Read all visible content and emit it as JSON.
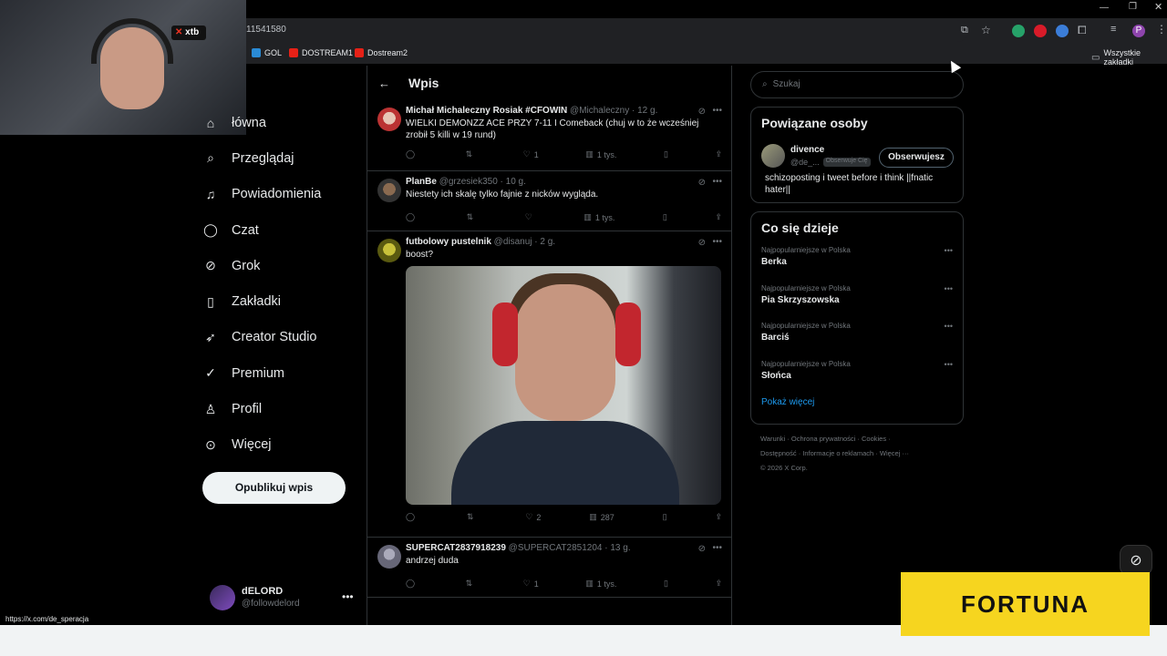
{
  "browser": {
    "url_fragment": "11541580",
    "bookmarks": [
      "GOL",
      "DOSTREAM1",
      "Dostream2"
    ],
    "bookmarks_folder": "Wszystkie zakładki",
    "profile_initial": "P"
  },
  "overlay": {
    "xtb_label": "xtb",
    "sponsor": "FORTUNA"
  },
  "nav": {
    "items": [
      {
        "label": "łówna",
        "icon": "home-icon"
      },
      {
        "label": "Przeglądaj",
        "icon": "search-icon"
      },
      {
        "label": "Powiadomienia",
        "icon": "bell-icon"
      },
      {
        "label": "Czat",
        "icon": "chat-icon"
      },
      {
        "label": "Grok",
        "icon": "grok-icon"
      },
      {
        "label": "Zakładki",
        "icon": "bookmark-icon"
      },
      {
        "label": "Creator Studio",
        "icon": "rocket-icon"
      },
      {
        "label": "Premium",
        "icon": "verified-icon"
      },
      {
        "label": "Profil",
        "icon": "person-icon"
      },
      {
        "label": "Więcej",
        "icon": "more-circle-icon"
      }
    ],
    "post_button": "Opublikuj wpis",
    "account": {
      "name": "dELORD",
      "handle": "@followdelord"
    }
  },
  "status_url": "https://x.com/de_speracja",
  "main": {
    "title": "Wpis",
    "posts": [
      {
        "name": "Michał Michaleczny Rosiak #CFOWIN",
        "handle": "@Michaleczny",
        "time": "· 12 g.",
        "text": "WIELKI DEMONZZ ACE PRZY 7-11 I Comeback (chuj w to że wcześniej zrobił 5 killi w 19 rund)",
        "replies": "",
        "reposts": "",
        "likes": "1",
        "views": "1 tys."
      },
      {
        "name": "PlanBe",
        "handle": "@grzesiek350",
        "time": "· 10 g.",
        "text": "Niestety ich skalę tylko fajnie z nicków wygląda.",
        "replies": "",
        "reposts": "",
        "likes": "",
        "views": "1 tys."
      },
      {
        "name": "futbolowy pustelnik",
        "handle": "@disanuj",
        "time": "· 2 g.",
        "text": "boost?",
        "replies": "",
        "reposts": "",
        "likes": "2",
        "views": "287"
      },
      {
        "name": "SUPERCAT2837918239",
        "handle": "@SUPERCAT2851204",
        "time": "· 13 g.",
        "text": "andrzej duda",
        "replies": "",
        "reposts": "",
        "likes": "1",
        "views": "1 tys."
      }
    ]
  },
  "sidebar": {
    "search_placeholder": "Szukaj",
    "related_title": "Powiązane osoby",
    "related": {
      "name": "divence",
      "handle": "@de_...",
      "badge": "Obserwuje Cię",
      "follow_label": "Obserwujesz",
      "bio": "schizoposting i tweet before i think ||fnatic hater||"
    },
    "trends_title": "Co się dzieje",
    "trends": [
      {
        "context": "Najpopularniejsze w Polska",
        "name": "Berka"
      },
      {
        "context": "Najpopularniejsze w Polska",
        "name": "Pia Skrzyszowska"
      },
      {
        "context": "Najpopularniejsze w Polska",
        "name": "Barciś"
      },
      {
        "context": "Najpopularniejsze w Polska",
        "name": "Słońca"
      }
    ],
    "show_more": "Pokaż więcej",
    "footer_line1": "Warunki · Ochrona prywatności · Cookies ·",
    "footer_line2": "Dostępność · Informacje o reklamach · Więcej ···",
    "footer_line3": "© 2026 X Corp."
  },
  "colors": {
    "accent": "#1d9bf0",
    "sponsor": "#f6d51f",
    "background": "#000000"
  }
}
